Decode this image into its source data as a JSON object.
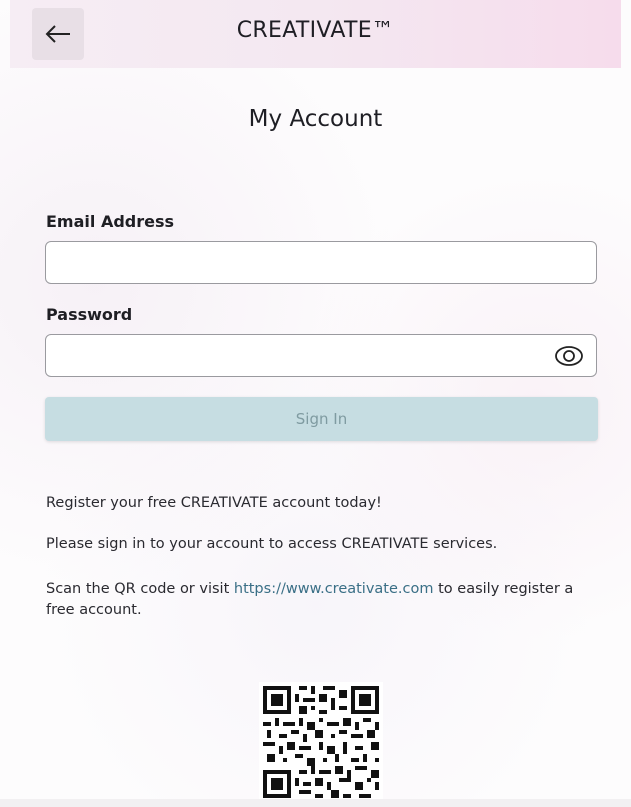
{
  "header": {
    "title": "CREATIVATE™",
    "back_icon": "arrow-left-icon"
  },
  "page": {
    "title": "My Account"
  },
  "form": {
    "email_label": "Email Address",
    "email_value": "",
    "email_placeholder": "",
    "password_label": "Password",
    "password_value": "",
    "password_placeholder": "",
    "password_toggle_icon": "eye-icon",
    "sign_in_label": "Sign In"
  },
  "info": {
    "register_text": "Register your free CREATIVATE account today!",
    "signin_text": "Please sign in to your account to access CREATIVATE services.",
    "scan_prefix": "Scan the QR code or visit ",
    "scan_link": "https://www.creativate.com",
    "scan_suffix": " to easily register a free account."
  },
  "qr_code": {
    "icon": "qr-code"
  },
  "colors": {
    "header_bg": "#f4e8f1",
    "button_bg": "#c6dde2",
    "button_text": "#7f9ba1",
    "link": "#3a6f86"
  }
}
